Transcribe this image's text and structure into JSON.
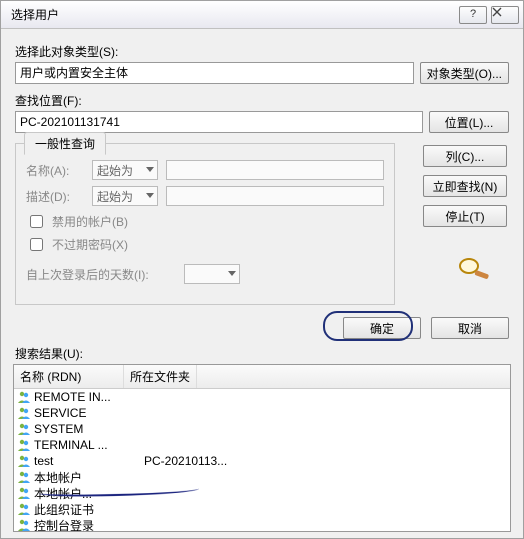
{
  "title": "选择用户",
  "labels": {
    "object_type": "选择此对象类型(S):",
    "object_type_value": "用户或内置安全主体",
    "btn_object_types": "对象类型(O)...",
    "location": "查找位置(F):",
    "location_value": "PC-202101131741",
    "btn_locations": "位置(L)...",
    "group_tab": "一般性查询",
    "name": "名称(A):",
    "desc": "描述(D):",
    "combo_start": "起始为",
    "chk_disabled": "禁用的帐户(B)",
    "chk_noexpire": "不过期密码(X)",
    "days_since": "自上次登录后的天数(I):",
    "btn_columns": "列(C)...",
    "btn_findnow": "立即查找(N)",
    "btn_stop": "停止(T)",
    "btn_ok": "确定",
    "btn_cancel": "取消",
    "results_label": "搜索结果(U):",
    "col_name": "名称 (RDN)",
    "col_folder": "所在文件夹"
  },
  "results": [
    {
      "name": "REMOTE IN...",
      "folder": ""
    },
    {
      "name": "SERVICE",
      "folder": ""
    },
    {
      "name": "SYSTEM",
      "folder": ""
    },
    {
      "name": "TERMINAL ...",
      "folder": ""
    },
    {
      "name": "test",
      "folder": "PC-20210113..."
    },
    {
      "name": "本地帐户",
      "folder": ""
    },
    {
      "name": "本地帐户...",
      "folder": ""
    },
    {
      "name": "此组织证书",
      "folder": ""
    },
    {
      "name": "控制台登录",
      "folder": ""
    }
  ]
}
